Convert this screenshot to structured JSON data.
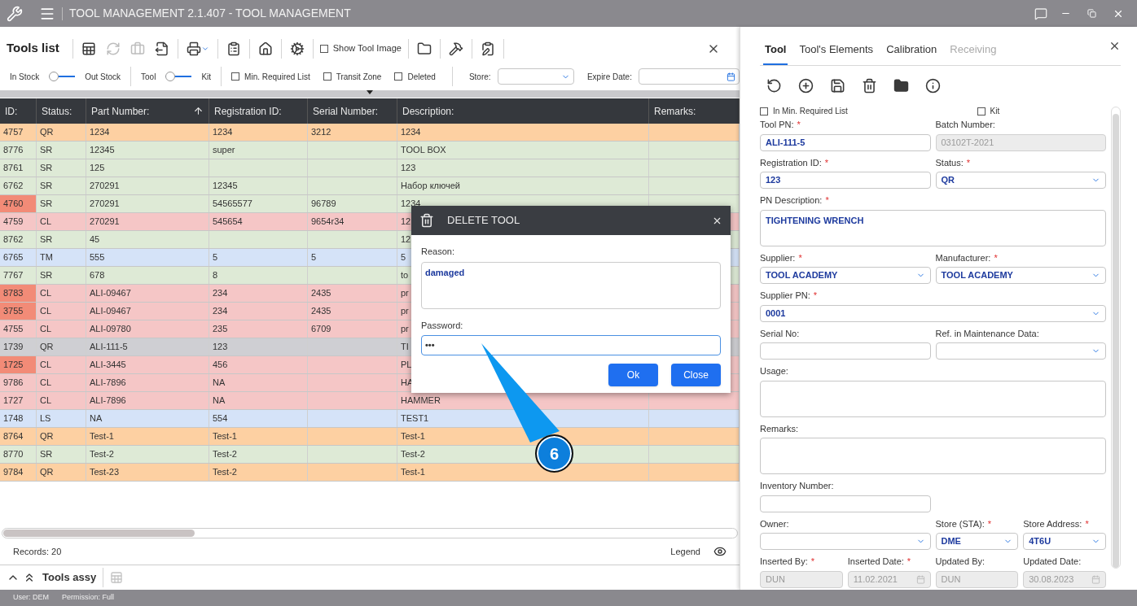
{
  "window": {
    "title": "TOOL MANAGEMENT 2.1.407 - TOOL MANAGEMENT"
  },
  "tools_list": {
    "title": "Tools list",
    "toolbar_buttons": [
      {
        "kind": "sheet",
        "disabled": false
      },
      {
        "kind": "refresh",
        "disabled": true
      },
      {
        "kind": "toolbox",
        "disabled": true
      },
      {
        "kind": "export",
        "disabled": false
      },
      {
        "kind": "print",
        "disabled": false
      },
      {
        "kind": "clipboard",
        "disabled": false
      },
      {
        "kind": "home",
        "disabled": false
      },
      {
        "kind": "gear",
        "disabled": false
      }
    ],
    "show_tool_image": {
      "label": "Show Tool Image",
      "checked": false
    },
    "toolbar_buttons_2": [
      {
        "kind": "folder",
        "disabled": false
      },
      {
        "kind": "tools",
        "disabled": false
      },
      {
        "kind": "edit",
        "disabled": false
      }
    ],
    "toggles": [
      {
        "left": "In Stock",
        "right": "Out Stock",
        "on": false
      },
      {
        "left": "Tool",
        "right": "Kit",
        "on": false
      }
    ],
    "filters": [
      {
        "label": "Min. Required List",
        "checked": false
      },
      {
        "label": "Transit Zone",
        "checked": false
      },
      {
        "label": "Deleted",
        "checked": false
      }
    ],
    "store": {
      "label": "Store:"
    },
    "expire_date": {
      "label": "Expire Date:"
    }
  },
  "table": {
    "columns": [
      {
        "label": "ID:"
      },
      {
        "label": "Status:"
      },
      {
        "label": "Part Number:",
        "sorted": true
      },
      {
        "label": "Registration ID:"
      },
      {
        "label": "Serial Number:"
      },
      {
        "label": "Description:"
      },
      {
        "label": "Remarks:"
      }
    ],
    "rows": [
      {
        "id": "4757",
        "status": "QR",
        "part_number": "1234",
        "registration_id": "1234",
        "serial_number": "3212",
        "description": "1234",
        "color": "#fdd0a2",
        "flagged": false
      },
      {
        "id": "8776",
        "status": "SR",
        "part_number": "12345",
        "registration_id": "super",
        "description": "TOOL BOX",
        "color": "#deead6",
        "flagged": false
      },
      {
        "id": "8761",
        "status": "SR",
        "part_number": "125",
        "description": "123",
        "color": "#deead6",
        "flagged": false
      },
      {
        "id": "6762",
        "status": "SR",
        "part_number": "270291",
        "registration_id": "12345",
        "description": "Набор ключей",
        "color": "#deead6",
        "flagged": false
      },
      {
        "id": "4760",
        "status": "SR",
        "part_number": "270291",
        "registration_id": "54565577",
        "serial_number": "96789",
        "description": "1234",
        "color": "#deead6",
        "flagged": true
      },
      {
        "id": "4759",
        "status": "CL",
        "part_number": "270291",
        "registration_id": "545654",
        "serial_number": "9654r34",
        "description": "12",
        "color": "#f5c6c6",
        "flagged": false
      },
      {
        "id": "8762",
        "status": "SR",
        "part_number": "45",
        "description": "12",
        "color": "#deead6",
        "flagged": false
      },
      {
        "id": "6765",
        "status": "TM",
        "part_number": "555",
        "registration_id": "5",
        "serial_number": "5",
        "description": "5",
        "color": "#d5e3f8",
        "flagged": false
      },
      {
        "id": "7767",
        "status": "SR",
        "part_number": "678",
        "registration_id": "8",
        "description": "to",
        "color": "#deead6",
        "flagged": false
      },
      {
        "id": "8783",
        "status": "CL",
        "part_number": "ALI-09467",
        "registration_id": "234",
        "serial_number": "2435",
        "description": "pr",
        "color": "#f5c6c6",
        "flagged": true
      },
      {
        "id": "3755",
        "status": "CL",
        "part_number": "ALI-09467",
        "registration_id": "234",
        "serial_number": "2435",
        "description": "pr",
        "color": "#f5c6c6",
        "flagged": true
      },
      {
        "id": "4755",
        "status": "CL",
        "part_number": "ALI-09780",
        "registration_id": "235",
        "serial_number": "6709",
        "description": "pr",
        "color": "#f5c6c6",
        "flagged": false
      },
      {
        "id": "1739",
        "status": "QR",
        "part_number": "ALI-111-5",
        "registration_id": "123",
        "description": "TI",
        "color": "#cfcfd3",
        "flagged": false
      },
      {
        "id": "1725",
        "status": "CL",
        "part_number": "ALI-3445",
        "registration_id": "456",
        "description": "PL",
        "color": "#f5c6c6",
        "flagged": true
      },
      {
        "id": "9786",
        "status": "CL",
        "part_number": "ALI-7896",
        "registration_id": "NA",
        "description": "HA",
        "color": "#f5c6c6",
        "flagged": false
      },
      {
        "id": "1727",
        "status": "CL",
        "part_number": "ALI-7896",
        "registration_id": "NA",
        "description": "HAMMER",
        "color": "#f5c6c6",
        "flagged": false
      },
      {
        "id": "1748",
        "status": "LS",
        "part_number": "NA",
        "registration_id": "554",
        "description": "TEST1",
        "color": "#d5e3f8",
        "flagged": false
      },
      {
        "id": "8764",
        "status": "QR",
        "part_number": "Test-1",
        "registration_id": "Test-1",
        "description": "Test-1",
        "color": "#fdd0a2",
        "flagged": false
      },
      {
        "id": "8770",
        "status": "SR",
        "part_number": "Test-2",
        "registration_id": "Test-2",
        "description": "Test-2",
        "color": "#deead6",
        "flagged": false
      },
      {
        "id": "9784",
        "status": "QR",
        "part_number": "Test-23",
        "registration_id": "Test-2",
        "description": "Test-1",
        "color": "#fdd0a2",
        "flagged": false
      }
    ]
  },
  "footer": {
    "records": "Records: 20",
    "legend": "Legend"
  },
  "tools_assy": {
    "title": "Tools assy"
  },
  "status_bar": {
    "user": "User: DEM",
    "permission": "Permission: Full"
  },
  "dialog": {
    "title": "DELETE TOOL",
    "reason_label": "Reason:",
    "reason": "damaged",
    "password_label": "Password:",
    "password": "•••",
    "buttons": [
      "Ok",
      "Close"
    ]
  },
  "callout": {
    "number": "6"
  },
  "tool_panel": {
    "tabs": [
      {
        "label": "Tool",
        "selected": true,
        "disabled": false
      },
      {
        "label": "Tool's Elements",
        "selected": false,
        "disabled": false
      },
      {
        "label": "Calibration",
        "selected": false,
        "disabled": false
      },
      {
        "label": "Receiving",
        "selected": false,
        "disabled": true
      }
    ],
    "checks": [
      {
        "label": "In Min. Required List",
        "checked": false
      },
      {
        "label": "Kit",
        "checked": false
      }
    ],
    "form_rows": [
      [
        {
          "label": "Tool PN:",
          "mark": "*",
          "kind": "text",
          "value": "ALI-111-5",
          "disabled": false
        },
        {
          "label": "Batch Number:",
          "kind": "text",
          "value": "03102T-2021",
          "disabled": true
        }
      ],
      [
        {
          "label": "Registration ID:",
          "mark": "*",
          "kind": "text",
          "value": "123",
          "disabled": false
        },
        {
          "label": "Status:",
          "mark": "*",
          "kind": "select",
          "value": "QR",
          "disabled": false
        }
      ],
      [
        {
          "label": "PN Description:",
          "mark": "*",
          "kind": "textarea",
          "value": "TIGHTENING WRENCH",
          "disabled": false
        }
      ],
      [
        {
          "label": "Supplier:",
          "mark": "*",
          "kind": "select",
          "value": "TOOL ACADEMY",
          "disabled": false
        },
        {
          "label": "Manufacturer:",
          "mark": "*",
          "kind": "select",
          "value": "TOOL ACADEMY",
          "disabled": false
        }
      ],
      [
        {
          "label": "Supplier PN:",
          "mark": "*",
          "kind": "select",
          "value": "0001",
          "disabled": false
        }
      ],
      [
        {
          "label": "Serial No:",
          "kind": "text",
          "disabled": false
        },
        {
          "label": "Ref. in Maintenance Data:",
          "kind": "select",
          "disabled": false
        }
      ],
      [
        {
          "label": "Usage:",
          "kind": "textarea",
          "disabled": false
        }
      ],
      [
        {
          "label": "Remarks:",
          "kind": "textarea",
          "disabled": false
        }
      ],
      [
        {
          "label": "Inventory Number:",
          "kind": "text",
          "disabled": false
        }
      ],
      [
        {
          "label": "Owner:",
          "kind": "select",
          "disabled": false
        },
        {
          "label": "Store (STA):",
          "mark": "*",
          "kind": "select",
          "value": "DME",
          "disabled": false
        },
        {
          "label": "Store Address:",
          "mark": "*",
          "kind": "select",
          "value": "4T6U",
          "disabled": false
        }
      ],
      [
        {
          "label": "Inserted By:",
          "mark": "*",
          "kind": "text",
          "value": "DUN",
          "disabled": true
        },
        {
          "label": "Inserted Date:",
          "mark": "*",
          "kind": "date",
          "value": "11.02.2021",
          "disabled": true
        },
        {
          "label": "Updated By:",
          "kind": "text",
          "value": "DUN",
          "disabled": true
        },
        {
          "label": "Updated Date:",
          "kind": "date",
          "value": "30.08.2023",
          "disabled": true
        }
      ]
    ]
  }
}
